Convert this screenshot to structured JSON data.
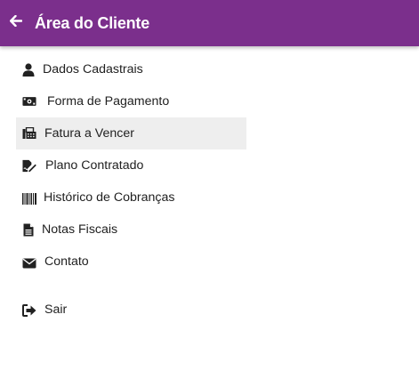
{
  "header": {
    "back_icon": "arrow-left-icon",
    "title": "Área do Cliente",
    "background": "#7b2f8c"
  },
  "menu": {
    "active_item": "Fatura a Vencer",
    "items": [
      {
        "label": "Dados Cadastrais",
        "icon": "user-icon"
      },
      {
        "label": "Forma de Pagamento",
        "icon": "money-bill-icon"
      },
      {
        "label": "Fatura a Vencer",
        "icon": "fax-icon"
      },
      {
        "label": "Plano Contratado",
        "icon": "file-signature-icon"
      },
      {
        "label": "Histórico de Cobranças",
        "icon": "barcode-icon"
      },
      {
        "label": "Notas Fiscais",
        "icon": "file-text-icon"
      },
      {
        "label": "Contato",
        "icon": "envelope-icon"
      },
      {
        "label": "Sair",
        "icon": "sign-out-icon"
      }
    ]
  }
}
